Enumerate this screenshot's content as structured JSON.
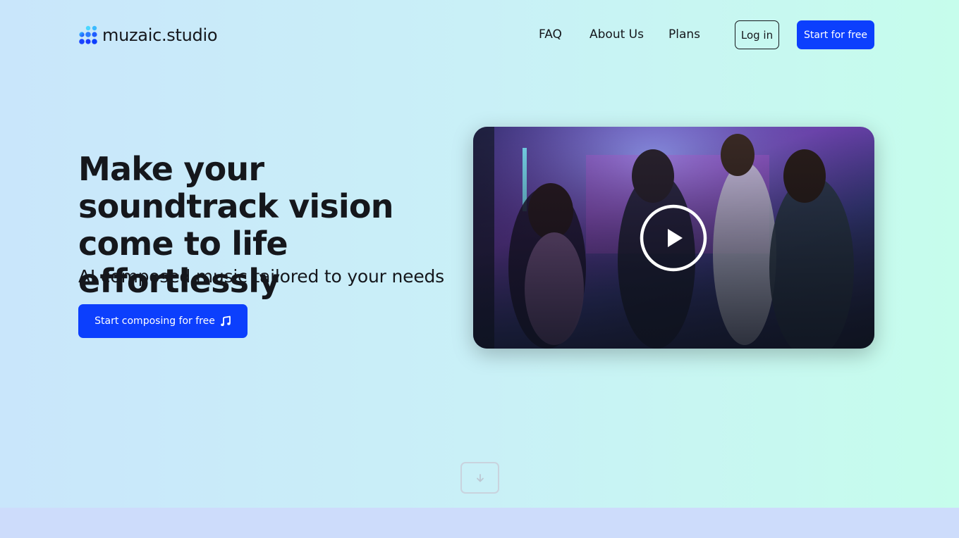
{
  "brand": {
    "name": "muzaic.studio",
    "logo_icon": "dot-grid-logo-icon"
  },
  "nav": {
    "links": [
      "FAQ",
      "About Us",
      "Plans"
    ],
    "login_label": "Log in",
    "start_label": "Start for free"
  },
  "hero": {
    "title": "Make your soundtrack vision come to life effortlessly",
    "subtitle": "AI composed music tailored to your needs",
    "cta_label": "Start composing for free",
    "cta_icon": "music-note-icon"
  },
  "video": {
    "play_icon": "play-icon"
  },
  "scroll": {
    "icon": "arrow-down-icon"
  },
  "colors": {
    "accent": "#0c3ffd",
    "text": "#15171c"
  }
}
